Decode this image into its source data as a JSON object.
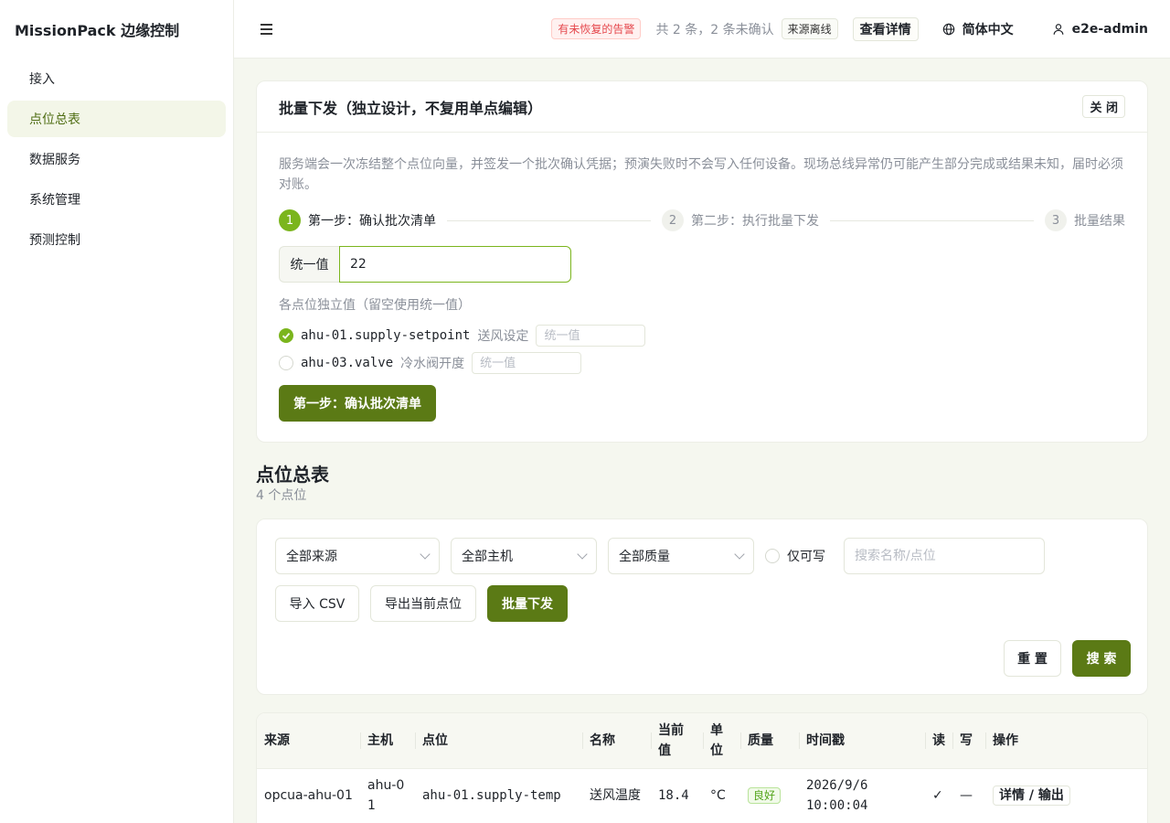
{
  "brand": "MissionPack 边缘控制",
  "sidebar": {
    "items": [
      {
        "label": "接入"
      },
      {
        "label": "点位总表"
      },
      {
        "label": "数据服务"
      },
      {
        "label": "系统管理"
      },
      {
        "label": "预测控制"
      }
    ],
    "active_index": 1
  },
  "header": {
    "alarm_tag": "有未恢复的告警",
    "alarm_count": "共 2 条，2 条未确认",
    "offline_tag": "来源离线",
    "detail_button": "查看详情",
    "language": "简体中文",
    "user": "e2e-admin"
  },
  "batch": {
    "title": "批量下发（独立设计，不复用单点编辑）",
    "close": "关 闭",
    "description": "服务端会一次冻结整个点位向量，并签发一个批次确认凭据；预演失败时不会写入任何设备。现场总线异常仍可能产生部分完成或结果未知，届时必须对账。",
    "steps": [
      {
        "num": "1",
        "label": "第一步：确认批次清单"
      },
      {
        "num": "2",
        "label": "第二步：执行批量下发"
      },
      {
        "num": "3",
        "label": "批量结果"
      }
    ],
    "unify_label": "统一值",
    "unify_value": "22",
    "per_point_label": "各点位独立值（留空使用统一值）",
    "points": [
      {
        "code": "ahu-01.supply-setpoint",
        "name": "送风设定",
        "placeholder": "统一值",
        "checked": true
      },
      {
        "code": "ahu-03.valve",
        "name": "冷水阀开度",
        "placeholder": "统一值",
        "checked": false
      }
    ],
    "confirm_button": "第一步：确认批次清单"
  },
  "overview": {
    "title": "点位总表",
    "count": "4 个点位"
  },
  "filters": {
    "source": "全部来源",
    "host": "全部主机",
    "quality": "全部质量",
    "writable_only": "仅可写",
    "search_placeholder": "搜索名称/点位",
    "import_csv": "导入 CSV",
    "export": "导出当前点位",
    "batch_write": "批量下发",
    "reset": "重 置",
    "search": "搜 索"
  },
  "table": {
    "columns": [
      "来源",
      "主机",
      "点位",
      "名称",
      "当前值",
      "单位",
      "质量",
      "时间戳",
      "读",
      "写",
      "操作"
    ],
    "rows": [
      {
        "source": "opcua-ahu-01",
        "host": "ahu-01",
        "point": "ahu-01.supply-temp",
        "name": "送风温度",
        "value": "18.4",
        "unit": "°C",
        "quality": "良好",
        "timestamp": "2026/9/6 10:00:04",
        "read": "✓",
        "write": "—",
        "action": "详情 / 输出"
      }
    ]
  },
  "colors": {
    "primary": "#5b7a15",
    "accent": "#7bb51d",
    "alarm": "#e5484d",
    "quality_good": "#52a41a"
  }
}
